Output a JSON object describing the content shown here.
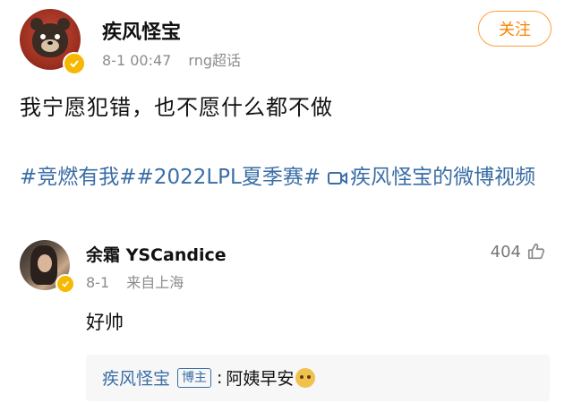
{
  "post": {
    "author": "疾风怪宝",
    "time": "8-1 00:47",
    "source": "rng超话",
    "follow_label": "关注",
    "text": "我宁愿犯错，也不愿什么都不做",
    "hashtags": [
      "#竞燃有我#",
      "#2022LPL夏季赛#"
    ],
    "video_link": "疾风怪宝的微博视频"
  },
  "comment": {
    "author": "余霜 YSCandice",
    "date": "8-1",
    "location": "来自上海",
    "likes": "404",
    "text": "好帅",
    "reply": {
      "author": "疾风怪宝",
      "tag": "博主",
      "separator": ":",
      "text": "阿姨早安"
    }
  },
  "colors": {
    "accent": "#ff8200",
    "link": "#3a6ea5",
    "meta": "#8c8c8c"
  },
  "icons": {
    "verified": "verified-badge-icon",
    "video": "video-icon",
    "like": "thumbs-up-icon",
    "emoji": "doge-emoji-icon"
  }
}
